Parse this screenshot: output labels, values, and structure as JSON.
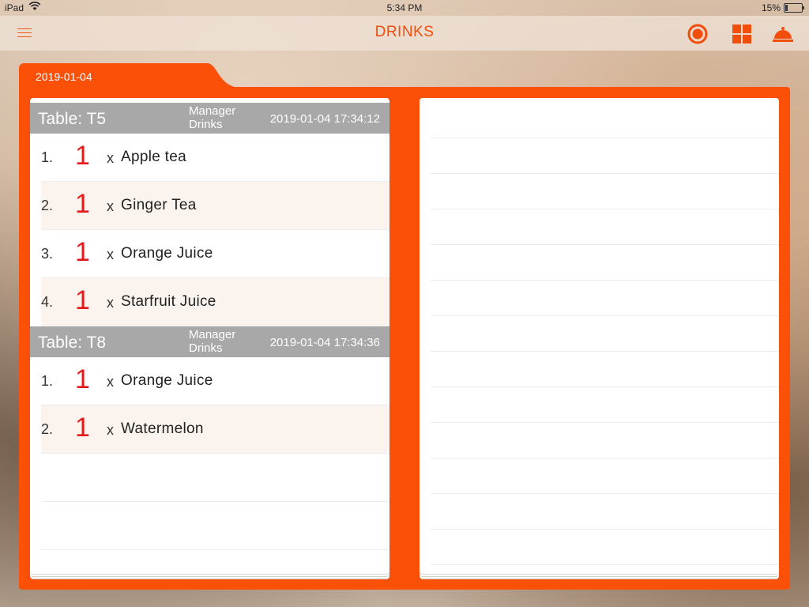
{
  "status": {
    "device": "iPad",
    "time": "5:34 PM",
    "battery": "15%"
  },
  "nav": {
    "title": "DRINKS"
  },
  "tab": {
    "date": "2019-01-04"
  },
  "orders": [
    {
      "table": "Table: T5",
      "role_line1": "Manager",
      "role_line2": "Drinks",
      "timestamp": "2019-01-04 17:34:12",
      "items": [
        {
          "num": "1.",
          "qty": "1",
          "x": "x",
          "name": "Apple tea"
        },
        {
          "num": "2.",
          "qty": "1",
          "x": "x",
          "name": "Ginger Tea"
        },
        {
          "num": "3.",
          "qty": "1",
          "x": "x",
          "name": "Orange Juice"
        },
        {
          "num": "4.",
          "qty": "1",
          "x": "x",
          "name": "Starfruit Juice"
        }
      ]
    },
    {
      "table": "Table: T8",
      "role_line1": "Manager",
      "role_line2": "Drinks",
      "timestamp": "2019-01-04 17:34:36",
      "items": [
        {
          "num": "1.",
          "qty": "1",
          "x": "x",
          "name": "Orange Juice"
        },
        {
          "num": "2.",
          "qty": "1",
          "x": "x",
          "name": "Watermelon"
        }
      ]
    }
  ],
  "colors": {
    "accent": "#fa5008",
    "header_gray": "#a8a8a8",
    "qty_red": "#e31a1a"
  },
  "icons": [
    "menu-icon",
    "record-icon",
    "grid-icon",
    "service-bell-icon",
    "wifi-icon",
    "battery-icon"
  ]
}
